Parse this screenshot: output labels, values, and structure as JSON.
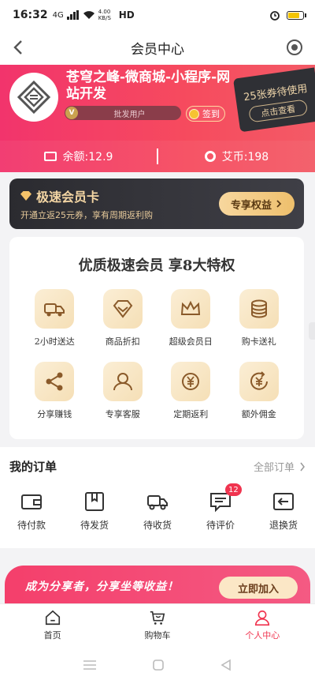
{
  "status_bar": {
    "time": "16:32",
    "network": "4G",
    "speed": "4.00 KB/S",
    "hd": "HD"
  },
  "nav": {
    "title": "会员中心"
  },
  "header": {
    "shop_name": "苍穹之峰-微商城-小程序-网站开发",
    "user_level": "批发用户",
    "level_badge": "V",
    "signin_label": "签到",
    "coupon_text": "25张券待使用",
    "coupon_button": "点击查看",
    "balance_label": "余额:12.9",
    "coins_label": "艾币:198"
  },
  "vip_card": {
    "title": "极速会员卡",
    "subtitle": "开通立返25元券，享有周期返利购",
    "button": "专享权益"
  },
  "privileges": {
    "title": "优质极速会员  享8大特权",
    "items": [
      {
        "label": "2小时送达",
        "icon": "delivery-truck-icon"
      },
      {
        "label": "商品折扣",
        "icon": "diamond-icon"
      },
      {
        "label": "超级会员日",
        "icon": "crown-icon"
      },
      {
        "label": "购卡送礼",
        "icon": "coin-stack-icon"
      },
      {
        "label": "分享赚钱",
        "icon": "share-icon"
      },
      {
        "label": "专享客服",
        "icon": "customer-service-icon"
      },
      {
        "label": "定期返利",
        "icon": "yuan-cycle-icon"
      },
      {
        "label": "额外佣金",
        "icon": "yuan-refresh-icon"
      }
    ]
  },
  "orders": {
    "title": "我的订单",
    "all_label": "全部订单",
    "items": [
      {
        "label": "待付款",
        "icon": "wallet-icon"
      },
      {
        "label": "待发货",
        "icon": "package-icon"
      },
      {
        "label": "待收货",
        "icon": "truck-icon"
      },
      {
        "label": "待评价",
        "icon": "comment-icon",
        "badge": "12"
      },
      {
        "label": "退换货",
        "icon": "return-icon"
      }
    ]
  },
  "share_banner": {
    "text": "成为分享者，分享坐等收益！",
    "button": "立即加入"
  },
  "tabbar": {
    "items": [
      {
        "label": "首页",
        "icon": "home-icon"
      },
      {
        "label": "购物车",
        "icon": "cart-icon"
      },
      {
        "label": "个人中心",
        "icon": "user-icon",
        "active": true
      }
    ]
  },
  "colors": {
    "brand": "#f0344f",
    "gold": "#f4d6a4",
    "dark_card": "#2b2b30"
  }
}
